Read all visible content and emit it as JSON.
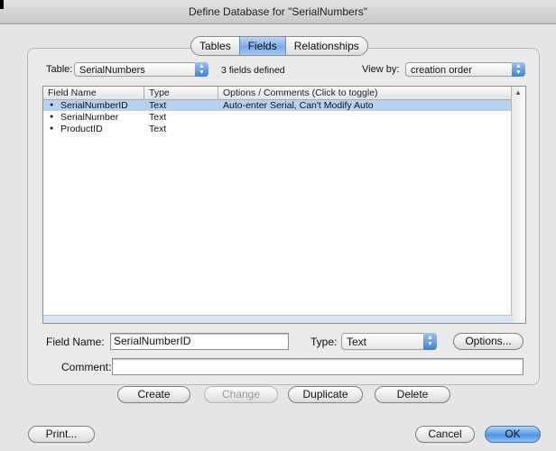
{
  "window": {
    "title": "Define Database for \"SerialNumbers\""
  },
  "tabs": [
    {
      "label": "Tables",
      "selected": false
    },
    {
      "label": "Fields",
      "selected": true
    },
    {
      "label": "Relationships",
      "selected": false
    }
  ],
  "table_selector": {
    "label": "Table:",
    "value": "SerialNumbers"
  },
  "fields_count_text": "3 fields defined",
  "view_by": {
    "label": "View by:",
    "value": "creation order"
  },
  "list": {
    "headers": [
      "Field Name",
      "Type",
      "Options / Comments   (Click to toggle)"
    ],
    "rows": [
      {
        "name": "SerialNumberID",
        "type": "Text",
        "options": "Auto-enter Serial, Can't Modify Auto"
      },
      {
        "name": "SerialNumber",
        "type": "Text",
        "options": ""
      },
      {
        "name": "ProductID",
        "type": "Text",
        "options": ""
      }
    ],
    "selected_index": 0
  },
  "field_name": {
    "label": "Field Name:",
    "value": "SerialNumberID"
  },
  "type_selector": {
    "label": "Type:",
    "value": "Text"
  },
  "comment": {
    "label": "Comment:",
    "value": ""
  },
  "buttons": {
    "options": "Options...",
    "create": "Create",
    "change": "Change",
    "duplicate": "Duplicate",
    "delete": "Delete",
    "print": "Print...",
    "cancel": "Cancel",
    "ok": "OK"
  },
  "colors": {
    "selection": "#b6d2f1",
    "default_button": "#4f94e6"
  }
}
